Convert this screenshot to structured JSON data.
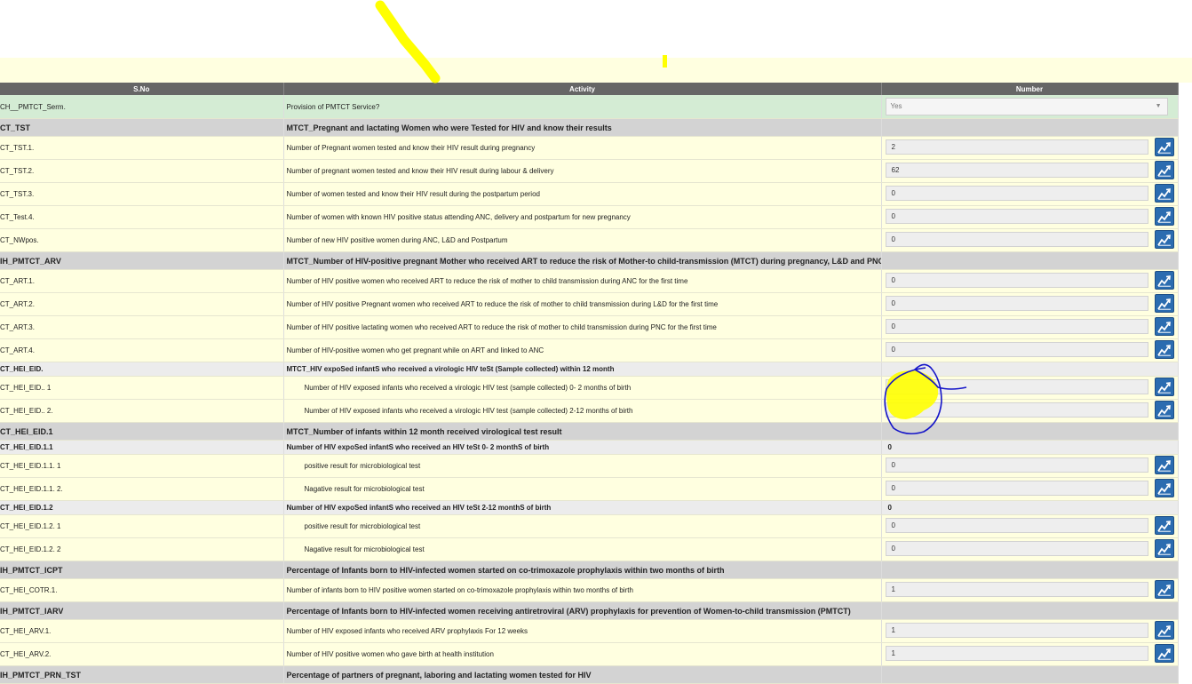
{
  "table": {
    "headers": {
      "sno": "S.No",
      "activity": "Activity",
      "number": "Number"
    },
    "rows": [
      {
        "kind": "select",
        "sno": "CH__PMTCT_Serm.",
        "activity": "Provision of PMTCT Service?",
        "value": "Yes"
      },
      {
        "kind": "section",
        "sno": "CT_TST",
        "activity": "MTCT_Pregnant and lactating Women who were Tested for HIV and know their results"
      },
      {
        "kind": "data",
        "sno": "CT_TST.1.",
        "activity": "Number of Pregnant women tested and know their HIV result during pregnancy",
        "value": "2"
      },
      {
        "kind": "data",
        "sno": "CT_TST.2.",
        "activity": "Number of pregnant women tested and know their HIV result during labour & delivery",
        "value": "62"
      },
      {
        "kind": "data",
        "sno": "CT_TST.3.",
        "activity": "Number of women tested and know their HIV result during the postpartum period",
        "value": "0"
      },
      {
        "kind": "data",
        "sno": "CT_Test.4.",
        "activity": "Number of women with known HIV positive status attending ANC, delivery and postpartum for new pregnancy",
        "value": "0"
      },
      {
        "kind": "data",
        "sno": "CT_NWpos.",
        "activity": "Number of new HIV positive women during ANC, L&D and Postpartum",
        "value": "0"
      },
      {
        "kind": "section",
        "sno": "IH_PMTCT_ARV",
        "activity": "MTCT_Number of HIV-positive pregnant Mother who received ART to reduce the risk of Mother-to child-transmission (MTCT) during pregnancy, L&D and PNC"
      },
      {
        "kind": "data",
        "sno": "CT_ART.1.",
        "activity": "Number of HIV positive women who received ART to reduce the risk of mother to child transmission during ANC for the first time",
        "value": "0"
      },
      {
        "kind": "data",
        "sno": "CT_ART.2.",
        "activity": "Number of HIV positive Pregnant women who received ART to reduce the risk of mother to child transmission during L&D for the first time",
        "value": "0"
      },
      {
        "kind": "data",
        "sno": "CT_ART.3.",
        "activity": "Number of HIV positive lactating women who received ART to reduce the risk of mother to child transmission during PNC for the first time",
        "value": "0"
      },
      {
        "kind": "data",
        "sno": "CT_ART.4.",
        "activity": "Number of HIV-positive women who get pregnant while on ART and linked to ANC",
        "value": "0"
      },
      {
        "kind": "subsection",
        "sno": "CT_HEI_EID.",
        "activity": "MTCT_HIV expoSed infantS who received a virologic HIV teSt (Sample collected) within 12 month",
        "value": ""
      },
      {
        "kind": "data",
        "indent": true,
        "sno": "CT_HEI_EID.. 1",
        "activity": "Number of HIV exposed infants who received a virologic HIV test (sample collected) 0- 2 months of birth",
        "value": ""
      },
      {
        "kind": "data",
        "indent": true,
        "sno": "CT_HEI_EID.. 2.",
        "activity": "Number of HIV exposed infants who received a virologic HIV test (sample collected) 2-12 months of birth",
        "value": ""
      },
      {
        "kind": "section",
        "sno": "CT_HEI_EID.1",
        "activity": "MTCT_Number of infants within 12 month received virological test result"
      },
      {
        "kind": "subsection",
        "sno": "CT_HEI_EID.1.1",
        "activity": "Number of HIV expoSed infantS who received an HIV teSt 0- 2 monthS of birth",
        "value": "0"
      },
      {
        "kind": "data",
        "indent": true,
        "sno": "CT_HEI_EID.1.1. 1",
        "activity": "positive result for microbiological test",
        "value": "0"
      },
      {
        "kind": "data",
        "indent": true,
        "sno": "CT_HEI_EID.1.1. 2.",
        "activity": "Nagative result for microbiological test",
        "value": "0"
      },
      {
        "kind": "subsection",
        "sno": "CT_HEI_EID.1.2",
        "activity": "Number of HIV expoSed infantS who received an HIV teSt 2-12 monthS of birth",
        "value": "0"
      },
      {
        "kind": "data",
        "indent": true,
        "sno": "CT_HEI_EID.1.2. 1",
        "activity": "positive result for microbiological test",
        "value": "0"
      },
      {
        "kind": "data",
        "indent": true,
        "sno": "CT_HEI_EID.1.2. 2",
        "activity": "Nagative result for microbiological test",
        "value": "0"
      },
      {
        "kind": "section",
        "sno": "IH_PMTCT_ICPT",
        "activity": "Percentage of Infants born to HIV-infected women started on co-trimoxazole prophylaxis within two months of birth"
      },
      {
        "kind": "data",
        "sno": "CT_HEI_COTR.1.",
        "activity": "Number of infants born to HIV positive women started on co-trimoxazole prophylaxis within two months of birth",
        "value": "1"
      },
      {
        "kind": "section",
        "sno": "IH_PMTCT_IARV",
        "activity": "Percentage of Infants born to HIV-infected women receiving antiretroviral (ARV) prophylaxis for prevention of Women-to-child transmission (PMTCT)"
      },
      {
        "kind": "data",
        "sno": "CT_HEI_ARV.1.",
        "activity": "Number of HIV exposed infants who received ARV prophylaxis For 12 weeks",
        "value": "1"
      },
      {
        "kind": "data",
        "sno": "CT_HEI_ARV.2.",
        "activity": "Number of HIV positive women who gave birth at health institution",
        "value": "1"
      },
      {
        "kind": "section",
        "sno": "IH_PMTCT_PRN_TST",
        "activity": "Percentage of partners of pregnant, laboring and lactating women tested for HIV"
      }
    ]
  },
  "icons": {
    "row_action": "line-chart-icon",
    "select_arrow": "dropdown-arrow-icon"
  },
  "colors": {
    "header_bg": "#666666",
    "data_row_bg": "#ffffe0",
    "section_row_bg": "#d3d3d3",
    "select_row_bg": "#d4ecd4",
    "button_bg": "#2b6cb0",
    "highlight_yellow": "#ffff00",
    "pen_blue": "#1515c8"
  }
}
